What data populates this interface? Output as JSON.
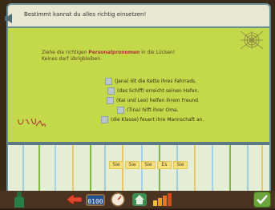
{
  "header": {
    "title": "Bestimmt kannst du alles richtig einsetzen!"
  },
  "instructions": {
    "line1_pre": "Ziehe die richtigen ",
    "line1_emph": "Personalpronomen",
    "line1_post": " in die Lücken!",
    "line2": "Keines darf übrigbleiben."
  },
  "tasks": [
    "(Jana) ölt die Kette ihres Fahrrads.",
    "(das Schiff) erreicht seinen Hafen.",
    "(Kai und Leo) helfen ihrem Freund.",
    "(Tina) hilft ihrer Oma.",
    "(die Klasse) feuert ihre Mannschaft an."
  ],
  "chips": [
    "Sie",
    "Sie",
    "Sie",
    "Es",
    "Sie"
  ],
  "toolbar": {
    "clock": "0100"
  },
  "colors": {
    "panel": "#c4d94a",
    "accent": "#b0303a",
    "frame": "#6b8d94"
  }
}
